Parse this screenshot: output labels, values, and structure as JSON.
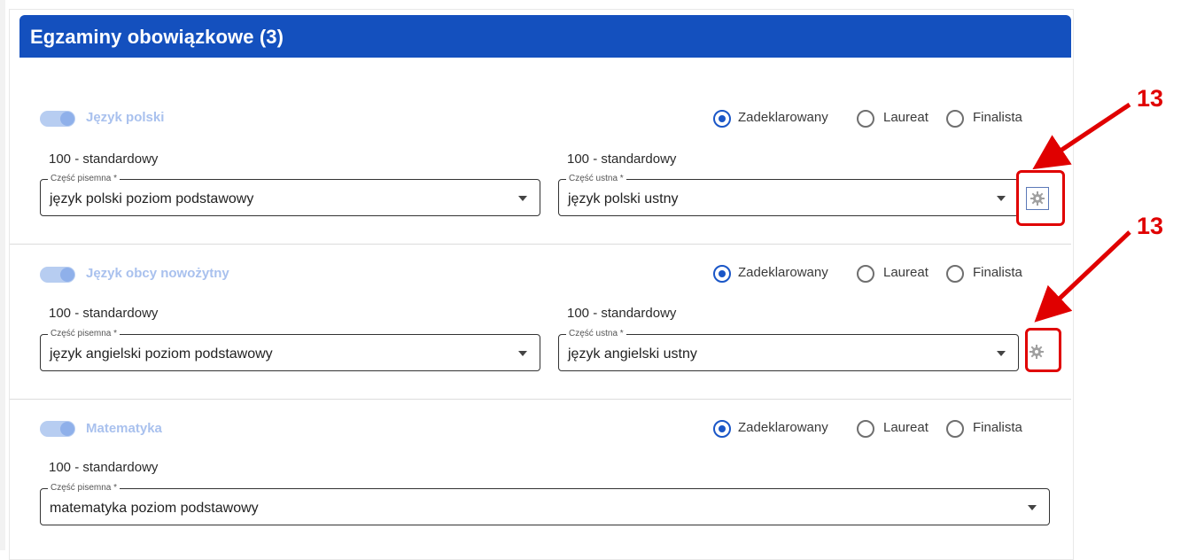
{
  "section": {
    "title": "Egzaminy obowiązkowe (3)"
  },
  "radio_labels": {
    "declared": "Zadeklarowany",
    "laureate": "Laureat",
    "finalist": "Finalista"
  },
  "exams": [
    {
      "subject": "Język polski",
      "written": {
        "level": "100 - standardowy",
        "label": "Część pisemna *",
        "value": "język polski poziom podstawowy"
      },
      "oral": {
        "level": "100 - standardowy",
        "label": "Część ustna *",
        "value": "język polski ustny"
      }
    },
    {
      "subject": "Język obcy nowożytny",
      "written": {
        "level": "100 - standardowy",
        "label": "Część pisemna *",
        "value": "język angielski poziom podstawowy"
      },
      "oral": {
        "level": "100 - standardowy",
        "label": "Część ustna *",
        "value": "język angielski ustny"
      }
    },
    {
      "subject": "Matematyka",
      "written": {
        "level": "100 - standardowy",
        "label": "Część pisemna *",
        "value": "matematyka poziom podstawowy"
      }
    }
  ],
  "annotations": [
    {
      "number": "13"
    },
    {
      "number": "13"
    }
  ],
  "colors": {
    "header": "#1450be",
    "accent": "#1a56c7",
    "annotation": "#e00000"
  },
  "icons": {
    "settings": "gear-icon",
    "dropdown": "chevron-down-icon"
  }
}
